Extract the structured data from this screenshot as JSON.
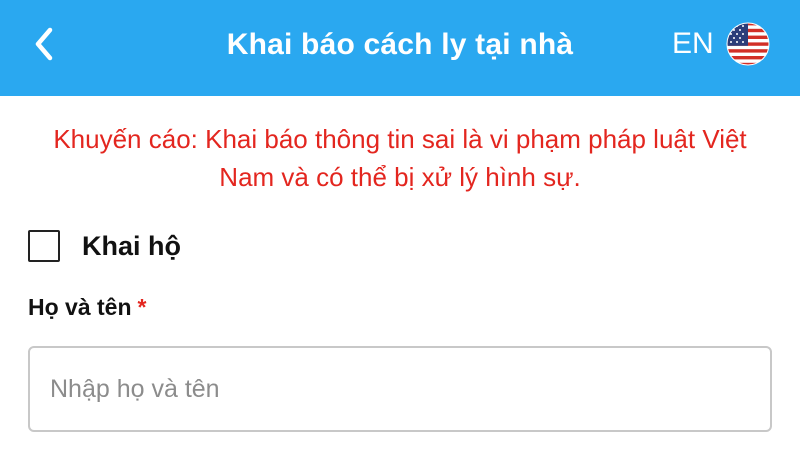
{
  "header": {
    "title": "Khai báo cách ly tại nhà",
    "lang_code": "EN",
    "back_icon": "chevron-left-icon",
    "flag_icon": "us-flag-icon",
    "background_color": "#2aa8f0"
  },
  "warning": {
    "text": "Khuyến cáo: Khai báo thông tin sai là vi phạm pháp luật Việt Nam và có thể bị xử lý hình sự.",
    "color": "#e3261f"
  },
  "proxy_declaration": {
    "label": "Khai hộ",
    "checked": false
  },
  "full_name": {
    "label": "Họ và tên",
    "required_mark": "*",
    "placeholder": "Nhập họ và tên",
    "value": ""
  }
}
